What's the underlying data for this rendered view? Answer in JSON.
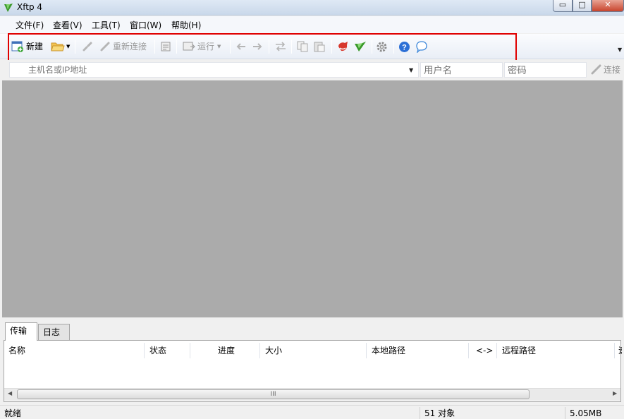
{
  "window": {
    "title": "Xftp 4",
    "controls": {
      "minimize": "▭",
      "maximize": "□",
      "close": "✕"
    }
  },
  "menu": [
    "文件(F)",
    "查看(V)",
    "工具(T)",
    "窗口(W)",
    "帮助(H)"
  ],
  "toolbar": {
    "new_label": "新建",
    "reconnect_label": "重新连接",
    "run_label": "运行",
    "icons": [
      "new-session-icon",
      "open-folder-icon",
      "disconnect-icon",
      "reconnect-icon",
      "properties-icon",
      "run-icon",
      "back-icon",
      "forward-icon",
      "sync-icon",
      "copy-icon",
      "paste-icon",
      "xshell-icon",
      "xftp-icon",
      "settings-icon",
      "help-icon",
      "feedback-icon"
    ]
  },
  "address": {
    "host_placeholder": "主机名或IP地址",
    "user_placeholder": "用户名",
    "password_placeholder": "密码",
    "connect_label": "连接"
  },
  "bottom_tabs": [
    "传输",
    "日志"
  ],
  "transfer_columns": [
    "名称",
    "状态",
    "进度",
    "大小",
    "本地路径",
    "<->",
    "远程路径",
    "速"
  ],
  "scrollbar_grip": "III",
  "status": {
    "ready": "就绪",
    "objects": "51 对象",
    "size": "5.05MB"
  },
  "colors": {
    "highlight": "#e00000",
    "workspace": "#ababab"
  }
}
